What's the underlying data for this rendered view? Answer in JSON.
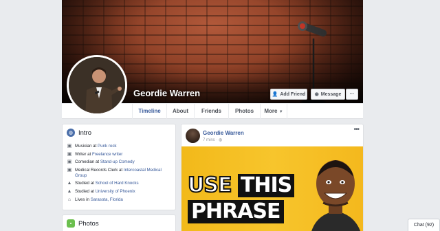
{
  "profile": {
    "name": "Geordie Warren",
    "add_friend_label": "Add Friend",
    "message_label": "Message",
    "more_dots": "···"
  },
  "tabs": [
    {
      "label": "Timeline"
    },
    {
      "label": "About"
    },
    {
      "label": "Friends"
    },
    {
      "label": "Photos"
    },
    {
      "label": "More"
    }
  ],
  "intro": {
    "title": "Intro",
    "items": [
      {
        "icon": "briefcase-icon",
        "prefix": "Musician at ",
        "link": "Punk rock",
        "suffix": ""
      },
      {
        "icon": "briefcase-icon",
        "prefix": "Writer at ",
        "link": "Freelance writer",
        "suffix": ""
      },
      {
        "icon": "briefcase-icon",
        "prefix": "Comedian at ",
        "link": "Stand-up Comedy",
        "suffix": ""
      },
      {
        "icon": "briefcase-icon",
        "prefix": "Medical Records Clerk at ",
        "link": "Intercoastal Medical Group",
        "suffix": ""
      },
      {
        "icon": "graduation-cap-icon",
        "prefix": "Studied at ",
        "link": "School of Hard Knocks",
        "suffix": ""
      },
      {
        "icon": "graduation-cap-icon",
        "prefix": "Studied at ",
        "link": "University of Phoenix",
        "suffix": ""
      },
      {
        "icon": "home-icon",
        "prefix": "Lives in ",
        "link": "Sarasota, Florida",
        "suffix": ""
      }
    ]
  },
  "photos": {
    "title": "Photos"
  },
  "post": {
    "author": "Geordie Warren",
    "time": "7 mins",
    "image_text": {
      "line1a": "USE",
      "line1b": "THIS",
      "line2": "PHRASE"
    }
  },
  "chat": {
    "label": "Chat (92)"
  },
  "colors": {
    "link": "#365899",
    "background": "#e9ebee",
    "thumbnail": "#f4b81d"
  }
}
